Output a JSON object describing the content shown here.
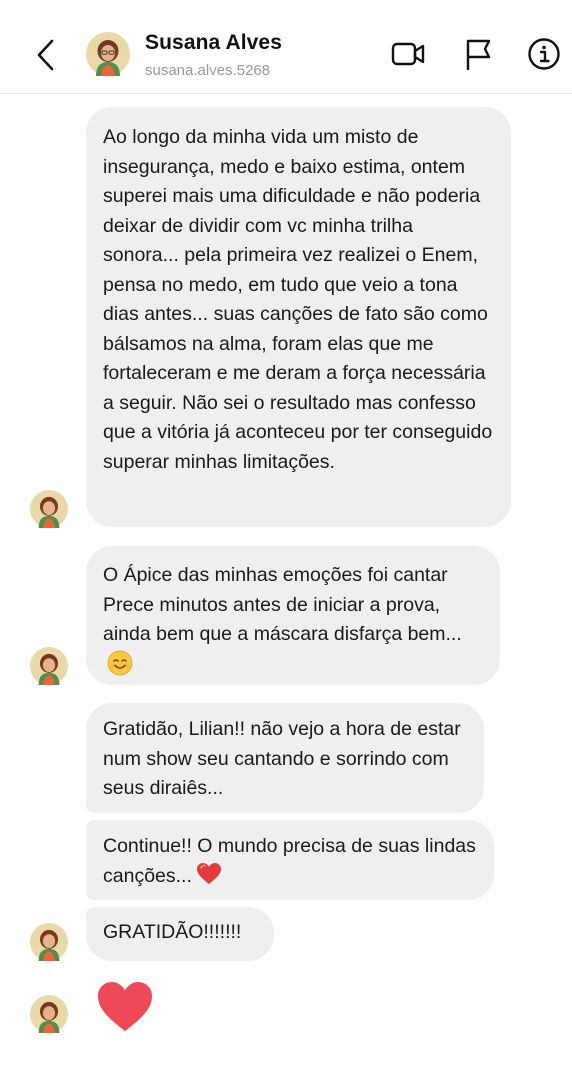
{
  "contact": {
    "name": "Susana Alves",
    "username": "susana.alves.5268"
  },
  "header": {
    "back_icon": "chevron-left-icon",
    "video_icon": "video-camera-icon",
    "report_icon": "flag-icon",
    "info_icon": "info-icon"
  },
  "messages": [
    {
      "text": "Ao longo da minha vida um misto de insegurança, medo e baixo estima, ontem superei mais uma dificuldade e não poderia deixar de dividir com vc minha trilha sonora... pela primeira vez realizei o Enem, pensa no medo, em tudo que veio a tona dias antes... suas canções de fato são como bálsamos na alma, foram elas que me fortaleceram e me deram a força necessária a seguir. Não sei o resultado mas confesso que a vitória já aconteceu por ter conseguido superar minhas limitações."
    },
    {
      "text": "O Ápice das minhas emoções foi cantar Prece minutos antes de iniciar a prova, ainda bem que a máscara disfarça bem...",
      "emoji": "smiling-face-emoji"
    },
    {
      "text": "Gratidão, Lilian!! não vejo a hora de estar num show seu cantando e sorrindo com seus diraiês..."
    },
    {
      "text": "Continue!! O mundo precisa de suas lindas canções...",
      "emoji": "red-heart-emoji"
    },
    {
      "text": "GRATIDÃO!!!!!!!"
    },
    {
      "emoji": "red-heart-emoji"
    }
  ],
  "colors": {
    "bubble": "#efefef",
    "heart": "#ee4956",
    "username": "#9a9a9a"
  }
}
